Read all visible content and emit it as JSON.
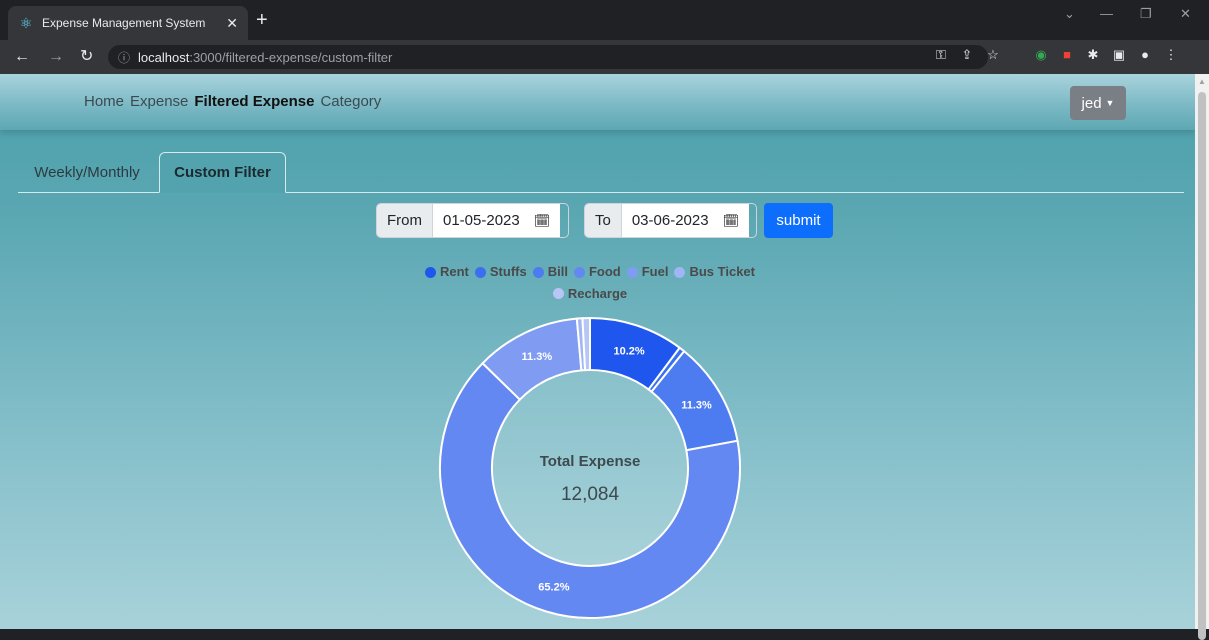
{
  "browser": {
    "tab_title": "Expense Management System",
    "url_host": "localhost",
    "url_path": ":3000/filtered-expense/custom-filter"
  },
  "nav": {
    "links": [
      "Home",
      "Expense",
      "Filtered Expense",
      "Category"
    ],
    "active": "Filtered Expense",
    "user": "jed"
  },
  "tabs": [
    "Weekly/Monthly",
    "Custom Filter"
  ],
  "filter": {
    "from_label": "From",
    "from_value": "01-05-2023",
    "to_label": "To",
    "to_value": "03-06-2023",
    "submit_label": "submit"
  },
  "colors": {
    "accent": "#0d6efd"
  },
  "chart_data": {
    "type": "doughnut",
    "center_label": "Total Expense",
    "center_value": "12,084",
    "legend": [
      {
        "name": "Rent",
        "color": "#1f57ee"
      },
      {
        "name": "Stuffs",
        "color": "#3a6ff0"
      },
      {
        "name": "Bill",
        "color": "#4c7cf0"
      },
      {
        "name": "Food",
        "color": "#6488f2"
      },
      {
        "name": "Fuel",
        "color": "#7f9cf2"
      },
      {
        "name": "Bus Ticket",
        "color": "#9fb5f4"
      },
      {
        "name": "Recharge",
        "color": "#b7c6f5"
      }
    ],
    "slices": [
      {
        "name": "Rent",
        "value": 10.2,
        "label": "10.2%"
      },
      {
        "name": "Stuffs",
        "value": 0.6,
        "label": ""
      },
      {
        "name": "Bill",
        "value": 11.3,
        "label": "11.3%"
      },
      {
        "name": "Food",
        "value": 65.2,
        "label": "65.2%"
      },
      {
        "name": "Fuel",
        "value": 11.3,
        "label": "11.3%"
      },
      {
        "name": "Bus Ticket",
        "value": 0.6,
        "label": ""
      },
      {
        "name": "Recharge",
        "value": 0.8,
        "label": ""
      }
    ]
  }
}
